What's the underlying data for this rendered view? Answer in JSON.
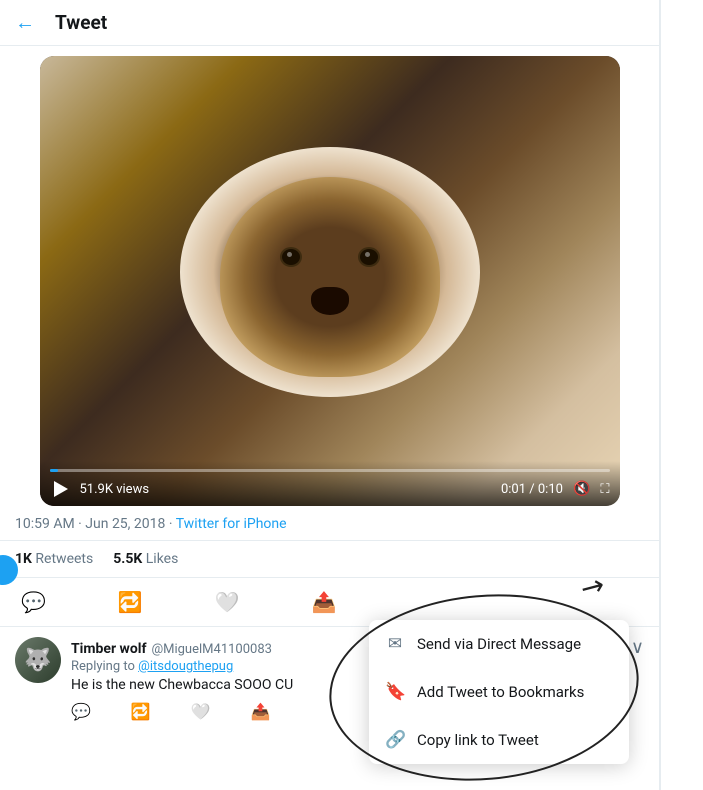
{
  "header": {
    "back_label": "←",
    "title": "Tweet"
  },
  "video": {
    "views": "51.9K views",
    "time_current": "0:01",
    "time_total": "0:10",
    "progress_pct": 1.6
  },
  "tweet_meta": {
    "time": "10:59 AM · Jun 25, 2018 · ",
    "source": "Twitter for iPhone"
  },
  "stats": {
    "retweets_count": "1K",
    "retweets_label": "Retweets",
    "likes_count": "5.5K",
    "likes_label": "Likes"
  },
  "actions": {
    "reply_icon": "💬",
    "retweet_icon": "🔁",
    "like_icon": "🤍",
    "share_icon": "📤"
  },
  "comment": {
    "avatar_emoji": "🐺",
    "display_name": "Timber wolf",
    "username": "@MiguelM41100083",
    "reply_to_label": "Replying to",
    "reply_to_user": "@itsdougthepug",
    "text": "He is the new Chewbacca SOOO CU",
    "expand_icon": "∨"
  },
  "context_menu": {
    "item1": {
      "icon": "✉",
      "label": "Send via Direct Message"
    },
    "item2": {
      "icon": "🔖",
      "label": "Add Tweet to Bookmarks"
    },
    "item3": {
      "icon": "🔗",
      "label": "Copy link to Tweet"
    }
  }
}
